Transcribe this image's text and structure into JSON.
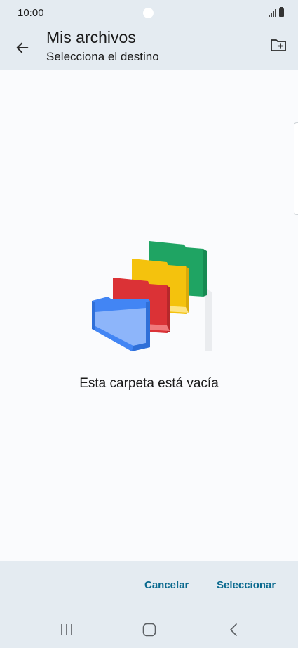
{
  "status_bar": {
    "time": "10:00"
  },
  "app_bar": {
    "title": "Mis archivos",
    "subtitle": "Selecciona el destino"
  },
  "empty_state": {
    "message": "Esta carpeta está vacía"
  },
  "actions": {
    "cancel": "Cancelar",
    "select": "Seleccionar"
  },
  "colors": {
    "accent": "#0b6a8f",
    "bar_background": "#e4ebf1",
    "folder_blue": "#4285f4",
    "folder_red": "#db3236",
    "folder_yellow": "#f4c20d",
    "folder_green": "#1fa463"
  },
  "icons": {
    "back": "arrow-left-icon",
    "new_folder": "folder-plus-icon",
    "nav_recent": "recent-apps-icon",
    "nav_home": "home-icon",
    "nav_back": "chevron-left-icon"
  }
}
